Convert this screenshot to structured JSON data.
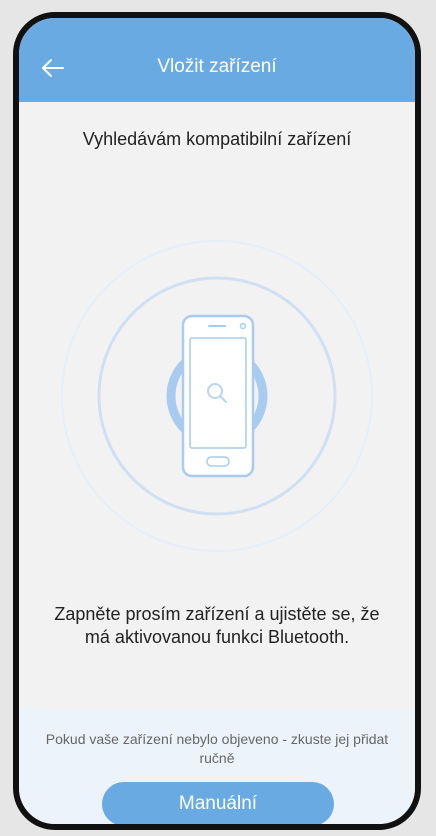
{
  "header": {
    "title": "Vložit zařízení",
    "back_icon": "arrow-left-icon"
  },
  "status": {
    "title": "Vyhledávám kompatibilní zařízení"
  },
  "illustration": {
    "phone_icon": "smartphone-icon",
    "search_icon": "search-icon"
  },
  "instruction": {
    "text": "Zapněte prosím zařízení a ujistěte se, že má aktivovanou funkci Bluetooth."
  },
  "footer": {
    "note": "Pokud vaše zařízení nebylo objeveno - zkuste jej přidat ručně",
    "manual_button_label": "Manuální"
  },
  "colors": {
    "accent": "#6aaae2",
    "ring": "#a9cbef",
    "footer_bg": "#edf3fa"
  }
}
